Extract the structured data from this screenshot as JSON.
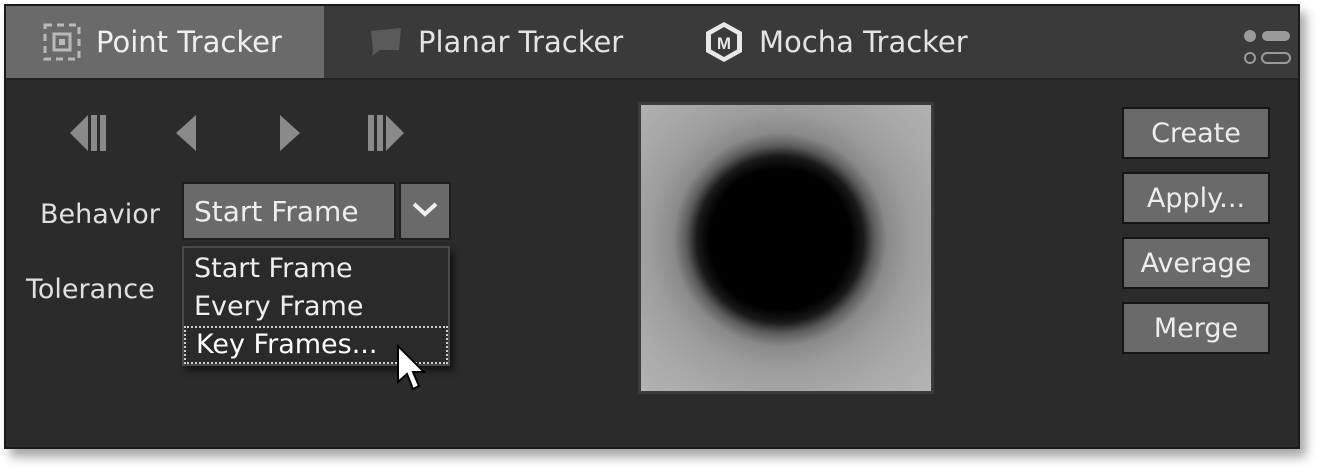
{
  "tabs": [
    {
      "label": "Point Tracker",
      "icon": "point-tracker-icon",
      "active": true
    },
    {
      "label": "Planar Tracker",
      "icon": "planar-tracker-icon",
      "active": false
    },
    {
      "label": "Mocha Tracker",
      "icon": "mocha-m-icon",
      "active": false
    }
  ],
  "mocha_icon_letter": "M",
  "playback": [
    "jump-to-start-icon",
    "step-back-icon",
    "step-forward-icon",
    "jump-to-end-icon"
  ],
  "behavior": {
    "label": "Behavior",
    "value": "Start Frame",
    "options": [
      "Start Frame",
      "Every Frame",
      "Key Frames..."
    ],
    "highlighted_option": "Key Frames..."
  },
  "tolerance": {
    "label": "Tolerance"
  },
  "actions": {
    "create": "Create",
    "apply": "Apply...",
    "average": "Average",
    "merge": "Merge"
  },
  "colors": {
    "panel_bg": "#2b2b2b",
    "tabbar_bg": "#3a3a3a",
    "active_tab": "#6a6a6a",
    "button_bg": "#6a6a6a",
    "text": "#e4e4e4"
  }
}
